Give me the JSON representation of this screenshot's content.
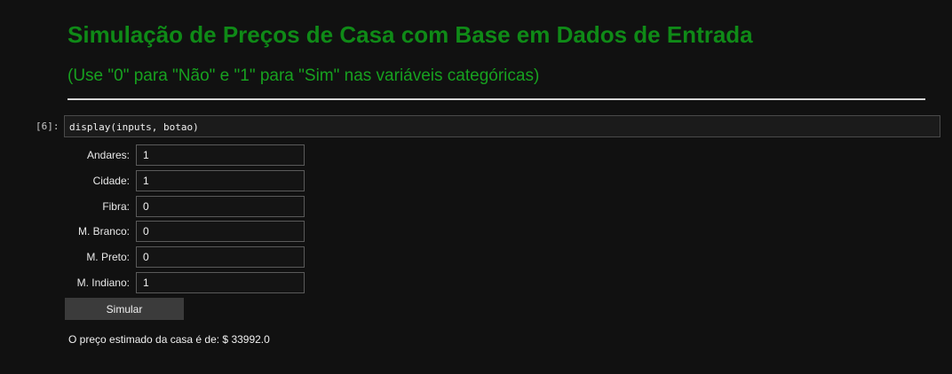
{
  "markdown": {
    "title": "Simulação de Preços de Casa com Base em Dados de Entrada",
    "subtitle": "(Use \"0\" para \"Não\" e \"1\" para \"Sim\" nas variáveis categóricas)"
  },
  "code_cell": {
    "prompt": "[6]:",
    "source": "display(inputs, botao)"
  },
  "form": {
    "fields": [
      {
        "label": "Andares:",
        "value": "1"
      },
      {
        "label": "Cidade:",
        "value": "1"
      },
      {
        "label": "Fibra:",
        "value": "0"
      },
      {
        "label": "M. Branco:",
        "value": "0"
      },
      {
        "label": "M. Preto:",
        "value": "0"
      },
      {
        "label": "M. Indiano:",
        "value": "1"
      }
    ],
    "button_label": "Simular"
  },
  "output": {
    "result_text": "O preço estimado da casa é de: $ 33992.0"
  }
}
